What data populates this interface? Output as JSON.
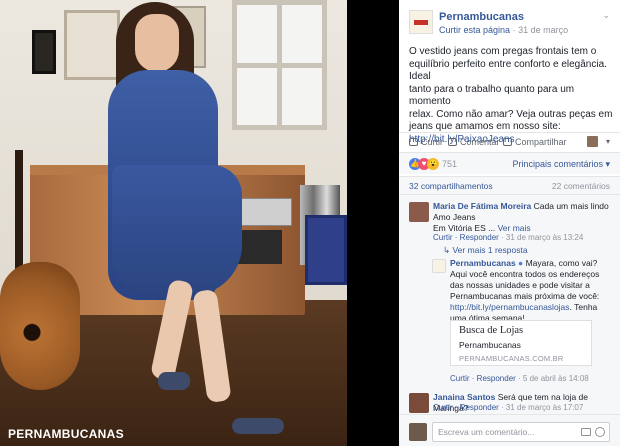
{
  "photo": {
    "brand_watermark": "PERNAMBUCANAS"
  },
  "post": {
    "page_name": "Pernambucanas",
    "like_page_label": "Curtir esta página",
    "separator": "·",
    "date": "31 de março",
    "chevron": "⌄",
    "text_lines": [
      "O vestido jeans com pregas frontais tem o",
      "equilíbrio perfeito entre conforto e elegância. Ideal",
      "tanto para o trabalho quanto para um momento",
      "relax. Como não amar? Veja outras peças em",
      "jeans que amamos em nosso site:"
    ],
    "link": "http://bit.ly/PaixaoJeans"
  },
  "actions": {
    "like": "Curtir",
    "comment": "Comentar",
    "share": "Compartilhar",
    "dropdown_chevron": "▾"
  },
  "reactions": {
    "like_glyph": "👍",
    "love_glyph": "♥",
    "wow_glyph": "😮",
    "count": "751",
    "top_comments": "Principais comentários ▾"
  },
  "stats": {
    "shares": "32 compartilhamentos",
    "comments": "22 comentários"
  },
  "comments": [
    {
      "author": "Maria De Fátima Moreira",
      "text": "Cada um mais lindo",
      "line2": "Amo Jeans",
      "line3": "Em Vitória ES ...",
      "more": "Ver mais",
      "reply_action": "Curtir · Responder",
      "timestamp": " · 31 de março às 13:24",
      "replies_link": "Ver mais 1 resposta"
    },
    {
      "author": "Pernambucanas",
      "text": "Mayara, como vai?",
      "lines": [
        "Aqui você encontra todos os endereços",
        "das nossas unidades e pode visitar a",
        "Pernambucanas mais próxima de você:"
      ],
      "link": "http://bit.ly/pernambucanaslojas",
      "after_link": ". Tenha",
      "closing": "uma ótima semana!",
      "reply_action": "Curtir · Responder",
      "timestamp": " · 5 de abril às 14:08"
    },
    {
      "author": "Janaina Santos",
      "text": "Será que tem na loja de Maringá?",
      "reply_action": "Curtir · Responder",
      "timestamp": " · 31 de março às 17:07"
    }
  ],
  "link_card": {
    "title": "Busca de Lojas",
    "subtitle": "Pernambucanas",
    "domain": "PERNAMBUCANAS.COM.BR"
  },
  "compose": {
    "placeholder": "Escreva um comentário..."
  },
  "colors": {
    "link_blue": "#365899",
    "meta_gray": "#90949c",
    "like_blue": "#4c7ce8",
    "love_red": "#f0506e",
    "wow_yellow": "#f7b928"
  }
}
